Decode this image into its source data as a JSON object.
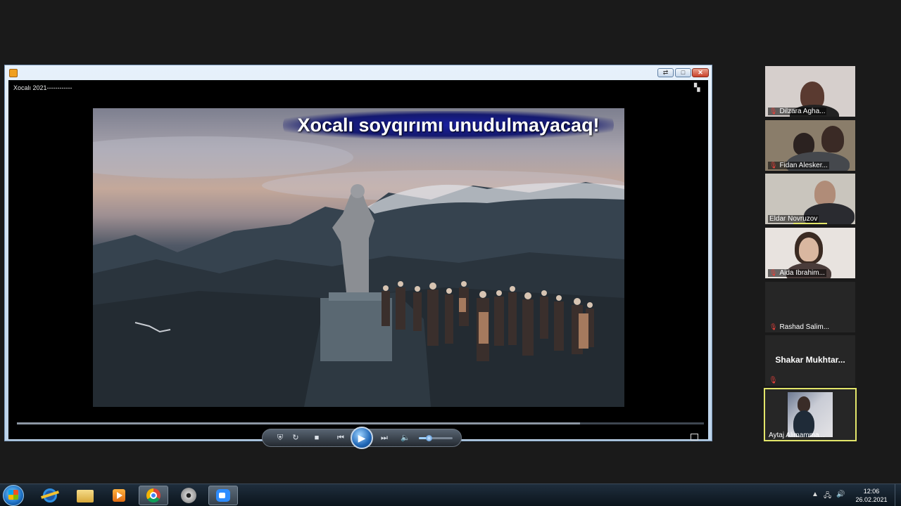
{
  "player": {
    "window_title": "Xocalı 2021------------",
    "caption": "Xocalı soyqırımı unudulmayacaq!",
    "progress": 0.82,
    "volume": 0.3,
    "buttons": {
      "shuffle": "shuffle",
      "repeat": "repeat",
      "stop": "stop",
      "previous": "previous",
      "play": "play",
      "next": "next",
      "mute": "mute"
    },
    "window_buttons": {
      "switch": "⇄",
      "restore": "□",
      "close": "✕"
    }
  },
  "participants": [
    {
      "name": "Dilzara Agha...",
      "muted": true
    },
    {
      "name": "Fidan Alesker...",
      "muted": true
    },
    {
      "name": "Eldar Novruzov",
      "muted": false
    },
    {
      "name": "Aida Ibrahim...",
      "muted": true
    },
    {
      "name": "Rashad Salim...",
      "muted": true
    },
    {
      "name": "Shakar  Mukhtar...",
      "muted": true
    },
    {
      "name": "Aytaj Alimamma...",
      "muted": false
    }
  ],
  "taskbar": {
    "apps": [
      "start-button",
      "ie-icon",
      "explorer-icon",
      "media-player-icon",
      "chrome-icon",
      "film-reel-icon",
      "zoom-icon"
    ],
    "active_app": "chrome-icon",
    "time": "12:06",
    "date": "26.02.2021"
  },
  "colors": {
    "active_speaker_border": "#e3e66a",
    "muted_mic": "#e5403a",
    "taskbar": "#0b141c"
  }
}
